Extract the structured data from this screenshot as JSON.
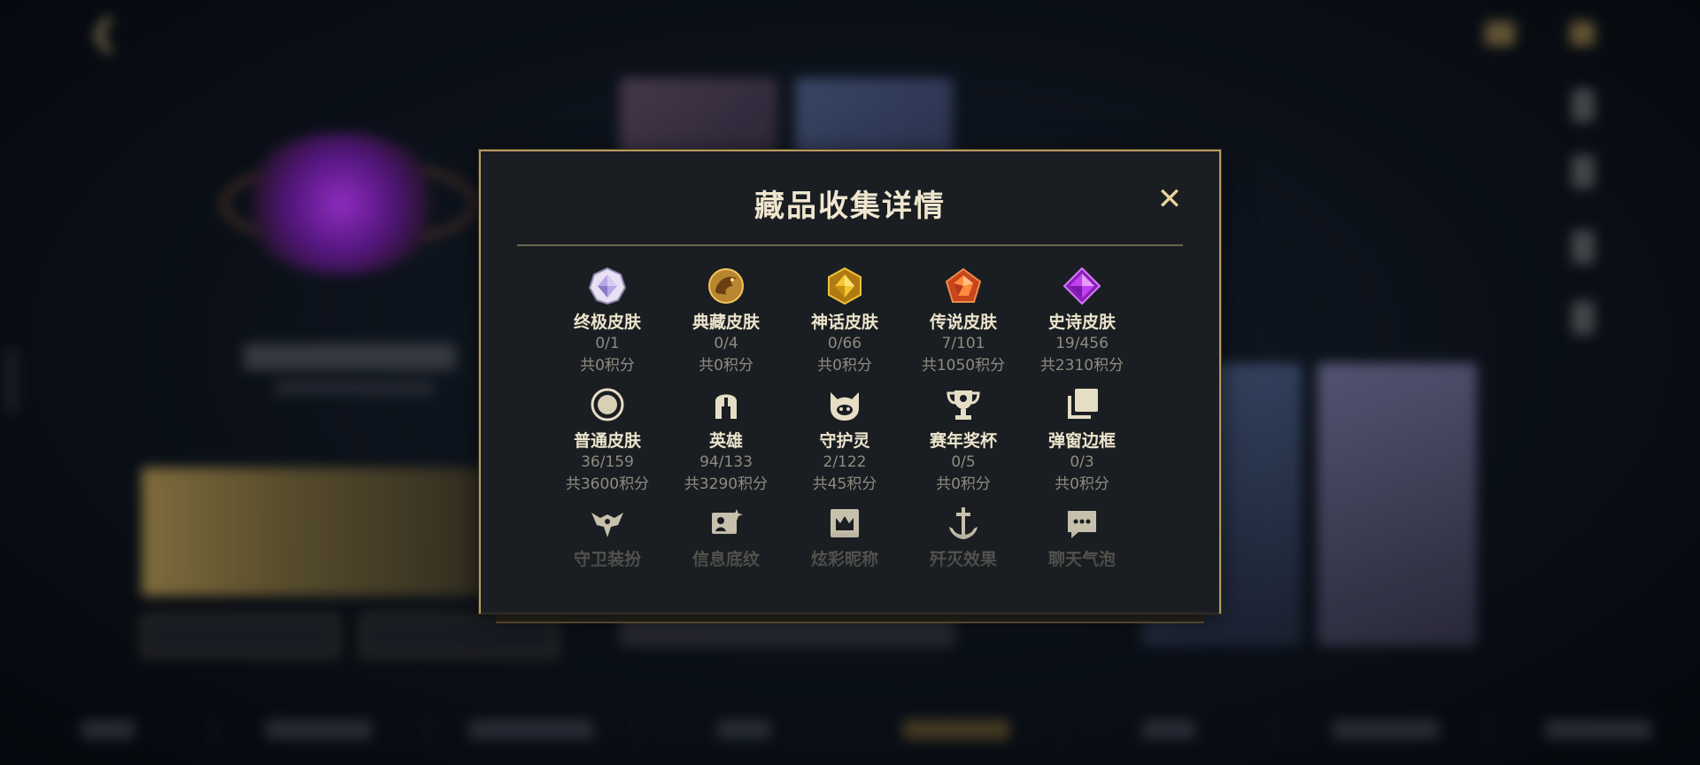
{
  "modal": {
    "title": "藏品收集详情",
    "close_label": "✕"
  },
  "colors": {
    "accent_gold": "#b89a5e",
    "modal_bg": "#1a1e22",
    "title_text": "#efe6cf",
    "muted_text": "#8e8b82"
  },
  "categories": [
    {
      "icon": "ultimate-skin-gem-icon",
      "name": "终极皮肤",
      "count": "0/1",
      "points": "共0积分"
    },
    {
      "icon": "collector-skin-dragon-icon",
      "name": "典藏皮肤",
      "count": "0/4",
      "points": "共0积分"
    },
    {
      "icon": "mythic-skin-gem-icon",
      "name": "神话皮肤",
      "count": "0/66",
      "points": "共0积分"
    },
    {
      "icon": "legendary-skin-gem-icon",
      "name": "传说皮肤",
      "count": "7/101",
      "points": "共1050积分"
    },
    {
      "icon": "epic-skin-gem-icon",
      "name": "史诗皮肤",
      "count": "19/456",
      "points": "共2310积分"
    },
    {
      "icon": "normal-skin-circle-icon",
      "name": "普通皮肤",
      "count": "36/159",
      "points": "共3600积分"
    },
    {
      "icon": "champion-helmet-icon",
      "name": "英雄",
      "count": "94/133",
      "points": "共3290积分"
    },
    {
      "icon": "guardian-spirit-icon",
      "name": "守护灵",
      "count": "2/122",
      "points": "共45积分"
    },
    {
      "icon": "trophy-icon",
      "name": "赛年奖杯",
      "count": "0/5",
      "points": "共0积分"
    },
    {
      "icon": "frame-stack-icon",
      "name": "弹窗边框",
      "count": "0/3",
      "points": "共0积分"
    },
    {
      "icon": "ward-skin-icon",
      "name": "守卫装扮",
      "count": "",
      "points": ""
    },
    {
      "icon": "banner-pattern-icon",
      "name": "信息底纹",
      "count": "",
      "points": ""
    },
    {
      "icon": "crown-title-icon",
      "name": "炫彩昵称",
      "count": "",
      "points": ""
    },
    {
      "icon": "anchor-effect-icon",
      "name": "歼灭效果",
      "count": "",
      "points": ""
    },
    {
      "icon": "chat-bubble-icon",
      "name": "聊天气泡",
      "count": "",
      "points": ""
    }
  ]
}
